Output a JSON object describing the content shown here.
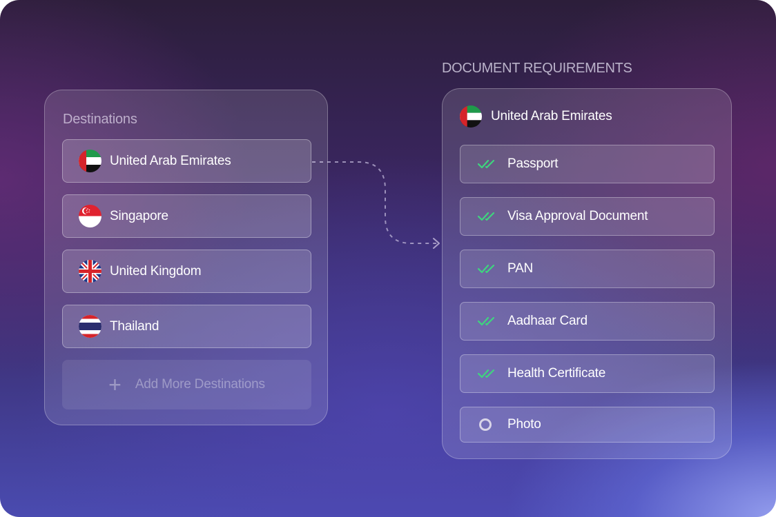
{
  "destinations": {
    "title": "Destinations",
    "items": [
      {
        "label": "United Arab Emirates",
        "flag": "uae-flag-icon"
      },
      {
        "label": "Singapore",
        "flag": "singapore-flag-icon"
      },
      {
        "label": "United Kingdom",
        "flag": "uk-flag-icon"
      },
      {
        "label": "Thailand",
        "flag": "thailand-flag-icon"
      }
    ],
    "add_label": "Add More Destinations",
    "add_icon": "plus-icon"
  },
  "requirements": {
    "heading": "DOCUMENT REQUIREMENTS",
    "country": "United Arab Emirates",
    "items": [
      {
        "label": "Passport",
        "status": "done",
        "icon": "double-check-icon"
      },
      {
        "label": "Visa Approval Document",
        "status": "done",
        "icon": "double-check-icon"
      },
      {
        "label": "PAN",
        "status": "done",
        "icon": "double-check-icon"
      },
      {
        "label": "Aadhaar Card",
        "status": "done",
        "icon": "double-check-icon"
      },
      {
        "label": "Health Certificate",
        "status": "done",
        "icon": "double-check-icon"
      },
      {
        "label": "Photo",
        "status": "pending",
        "icon": "circle-icon"
      }
    ]
  },
  "colors": {
    "check_green": "#3ed67e",
    "pending_ring": "#d8d4e8"
  }
}
